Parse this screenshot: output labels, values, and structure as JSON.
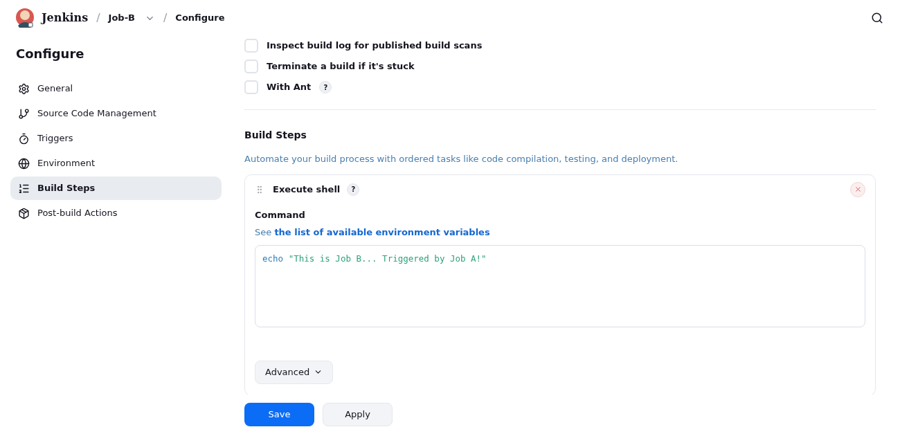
{
  "header": {
    "brand": "Jenkins",
    "breadcrumbs": [
      {
        "separator": "/",
        "label": "Job-B",
        "dropdown": true
      },
      {
        "separator": "/",
        "label": "Configure",
        "dropdown": false
      }
    ]
  },
  "sidebar": {
    "title": "Configure",
    "items": [
      {
        "label": "General",
        "selected": false
      },
      {
        "label": "Source Code Management",
        "selected": false
      },
      {
        "label": "Triggers",
        "selected": false
      },
      {
        "label": "Environment",
        "selected": false
      },
      {
        "label": "Build Steps",
        "selected": true
      },
      {
        "label": "Post-build Actions",
        "selected": false
      }
    ]
  },
  "options": [
    {
      "label": "Inspect build log for published build scans",
      "checked": false
    },
    {
      "label": "Terminate a build if it's stuck",
      "checked": false
    },
    {
      "label": "With Ant",
      "checked": false,
      "help": "?"
    }
  ],
  "section": {
    "title": "Build Steps",
    "description": "Automate your build process with ordered tasks like code compilation, testing, and deployment.",
    "step": {
      "title": "Execute shell",
      "help": "?",
      "field_label": "Command",
      "hint_prefix": "See",
      "hint_link": "the list of available environment variables",
      "command": [
        {
          "kind": "keyword",
          "text": "echo"
        },
        {
          "kind": "string",
          "text": "\"This is Job B... Triggered by Job A!\""
        }
      ],
      "advanced": "Advanced"
    }
  },
  "buttons": [
    {
      "label": "Save",
      "kind": "primary"
    },
    {
      "label": "Apply",
      "kind": "secondary"
    }
  ]
}
